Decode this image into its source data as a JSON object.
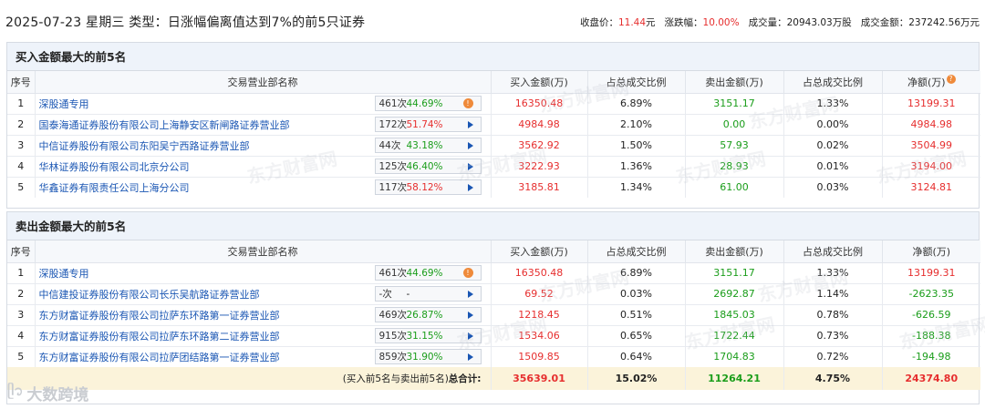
{
  "header": {
    "title": "2025-07-23 星期三 类型：日涨幅偏离值达到7%的前5只证券",
    "close_label": "收盘价：",
    "close_value": "11.44",
    "close_unit": "元",
    "change_label": "涨跌幅：",
    "change_value": "10.00%",
    "volume_label": "成交量：",
    "volume_value": "20943.03万股",
    "amount_label": "成交金额：",
    "amount_value": "237242.56万元"
  },
  "columns": {
    "idx": "序号",
    "name": "交易营业部名称",
    "buy_amt": "买入金额(万)",
    "buy_ratio": "占总成交比例",
    "sell_amt": "卖出金额(万)",
    "sell_ratio": "占总成交比例",
    "net": "净额(万)"
  },
  "buy_section": {
    "title": "买入金额最大的前5名",
    "rows": [
      {
        "idx": "1",
        "name": "深股通专用",
        "count": "461次",
        "pct": "44.69%",
        "pct_color": "green",
        "icon": "orange-info-icon",
        "buy": "16350.48",
        "buy_ratio": "6.89%",
        "sell": "3151.17",
        "sell_ratio": "1.33%",
        "net": "13199.31"
      },
      {
        "idx": "2",
        "name": "国泰海通证券股份有限公司上海静安区新闸路证券营业部",
        "count": "172次",
        "pct": "51.74%",
        "pct_color": "red",
        "icon": "play-arrow-icon",
        "buy": "4984.98",
        "buy_ratio": "2.10%",
        "sell": "0.00",
        "sell_ratio": "0.00%",
        "net": "4984.98"
      },
      {
        "idx": "3",
        "name": "中信证券股份有限公司东阳吴宁西路证券营业部",
        "count": "44次",
        "pct": "43.18%",
        "pct_color": "green",
        "icon": "play-arrow-icon",
        "buy": "3562.92",
        "buy_ratio": "1.50%",
        "sell": "57.93",
        "sell_ratio": "0.02%",
        "net": "3504.99"
      },
      {
        "idx": "4",
        "name": "华林证券股份有限公司北京分公司",
        "count": "125次",
        "pct": "46.40%",
        "pct_color": "green",
        "icon": "play-arrow-icon",
        "buy": "3222.93",
        "buy_ratio": "1.36%",
        "sell": "28.93",
        "sell_ratio": "0.01%",
        "net": "3194.00"
      },
      {
        "idx": "5",
        "name": "华鑫证券有限责任公司上海分公司",
        "count": "117次",
        "pct": "58.12%",
        "pct_color": "red",
        "icon": "play-arrow-icon",
        "buy": "3185.81",
        "buy_ratio": "1.34%",
        "sell": "61.00",
        "sell_ratio": "0.03%",
        "net": "3124.81"
      }
    ]
  },
  "sell_section": {
    "title": "卖出金额最大的前5名",
    "rows": [
      {
        "idx": "1",
        "name": "深股通专用",
        "count": "461次",
        "pct": "44.69%",
        "pct_color": "green",
        "icon": "orange-info-icon",
        "buy": "16350.48",
        "buy_ratio": "6.89%",
        "sell": "3151.17",
        "sell_ratio": "1.33%",
        "net": "13199.31",
        "net_color": "red"
      },
      {
        "idx": "2",
        "name": "中信建投证券股份有限公司长乐吴航路证券营业部",
        "count": "-次",
        "pct": "-",
        "pct_color": "blk",
        "icon": "play-arrow-icon",
        "buy": "69.52",
        "buy_ratio": "0.03%",
        "sell": "2692.87",
        "sell_ratio": "1.14%",
        "net": "-2623.35",
        "net_color": "green"
      },
      {
        "idx": "3",
        "name": "东方财富证券股份有限公司拉萨东环路第一证券营业部",
        "count": "469次",
        "pct": "26.87%",
        "pct_color": "green",
        "icon": "play-arrow-icon",
        "buy": "1218.45",
        "buy_ratio": "0.51%",
        "sell": "1845.03",
        "sell_ratio": "0.78%",
        "net": "-626.59",
        "net_color": "green"
      },
      {
        "idx": "4",
        "name": "东方财富证券股份有限公司拉萨东环路第二证券营业部",
        "count": "915次",
        "pct": "31.15%",
        "pct_color": "green",
        "icon": "play-arrow-icon",
        "buy": "1534.06",
        "buy_ratio": "0.65%",
        "sell": "1722.44",
        "sell_ratio": "0.73%",
        "net": "-188.38",
        "net_color": "green"
      },
      {
        "idx": "5",
        "name": "东方财富证券股份有限公司拉萨团结路第一证券营业部",
        "count": "859次",
        "pct": "31.90%",
        "pct_color": "green",
        "icon": "play-arrow-icon",
        "buy": "1509.85",
        "buy_ratio": "0.64%",
        "sell": "1704.83",
        "sell_ratio": "0.72%",
        "net": "-194.98",
        "net_color": "green"
      }
    ],
    "summary": {
      "label_prefix": "(买入前5名与卖出前5名)",
      "label_bold": "总合计:",
      "buy": "35639.01",
      "buy_ratio": "15.02%",
      "sell": "11264.21",
      "sell_ratio": "4.75%",
      "net": "24374.80"
    }
  },
  "watermark": {
    "text_cn": "东方财富网",
    "text_en": "eastmoney.com",
    "corner_logo": "大数跨境"
  },
  "colors": {
    "red": "#e62e2e",
    "green": "#1a9d1a",
    "link_blue": "#1a56b3",
    "header_bg": "#eef3fa",
    "summary_bg": "#fbf3da",
    "orange_icon": "#ef8a3a"
  }
}
